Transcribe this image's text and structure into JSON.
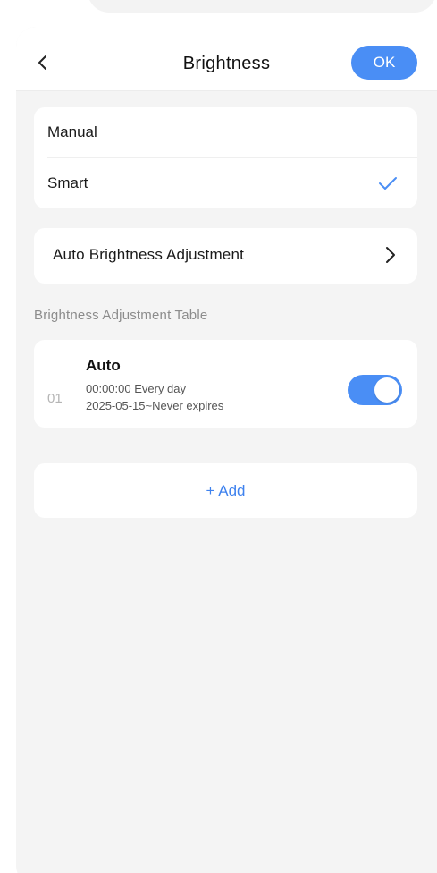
{
  "header": {
    "title": "Brightness",
    "ok_label": "OK"
  },
  "mode_options": [
    {
      "label": "Manual",
      "selected": false
    },
    {
      "label": "Smart",
      "selected": true
    }
  ],
  "auto_adjustment": {
    "label": "Auto Brightness Adjustment"
  },
  "section": {
    "title": "Brightness Adjustment Table"
  },
  "schedule": [
    {
      "index": "01",
      "name": "Auto",
      "time": "00:00:00 Every day",
      "range": "2025-05-15~Never expires",
      "enabled": true
    }
  ],
  "add_label": "+ Add",
  "colors": {
    "accent": "#4a8ef5",
    "panel_bg": "#f4f4f4",
    "card_bg": "#ffffff"
  },
  "icons": {
    "back": "chevron-left-icon",
    "selected": "checkmark-icon",
    "navigate": "chevron-right-icon"
  }
}
